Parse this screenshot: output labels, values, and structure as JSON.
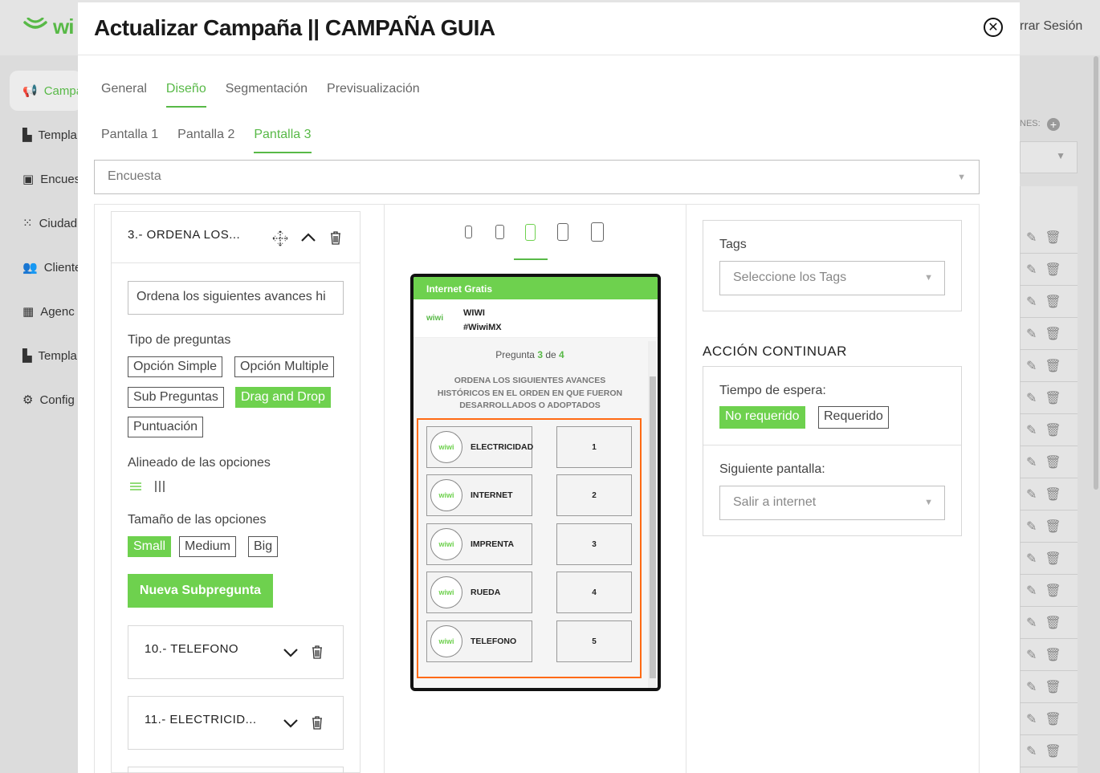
{
  "background": {
    "logo": "wi",
    "logout": "rrar Sesión",
    "sidebar": [
      "Campa",
      "Templa",
      "Encues",
      "Ciudad",
      "Cliente",
      "Agenc",
      "Templa",
      "Config"
    ],
    "right_header": "NES:"
  },
  "modal": {
    "title": "Actualizar Campaña || CAMPAÑA GUIA",
    "close_label": "✕",
    "tabs": [
      "General",
      "Diseño",
      "Segmentación",
      "Previsualización"
    ],
    "subtabs": [
      "Pantalla 1",
      "Pantalla 2",
      "Pantalla 3"
    ],
    "screen_type": "Encuesta"
  },
  "question": {
    "title": "3.- ORDENA LOS...",
    "input_value": "Ordena los siguientes avances hi",
    "tipo_label": "Tipo de preguntas",
    "tipos": [
      "Opción Simple",
      "Opción Multiple",
      "Sub Preguntas",
      "Drag and Drop",
      "Puntuación"
    ],
    "alineado_label": "Alineado de las opciones",
    "tamano_label": "Tamaño de las opciones",
    "tamanos": [
      "Small",
      "Medium",
      "Big"
    ],
    "new_sub_button": "Nueva Subpregunta",
    "subquestions": [
      "10.- TELEFONO",
      "11.- ELECTRICID..."
    ]
  },
  "preview": {
    "bar_title": "Internet Gratis",
    "logo_text": "wiwi",
    "brand_name": "WIWI",
    "brand_tag": "#WiwiMX",
    "pregunta_word": "Pregunta",
    "pregunta_current": "3",
    "pregunta_of": "de",
    "pregunta_total": "4",
    "question_text": "ORDENA LOS SIGUIENTES AVANCES HISTÓRICOS EN EL ORDEN EN QUE FUERON DESARROLLADOS O ADOPTADOS",
    "options": [
      "ELECTRICIDAD",
      "INTERNET",
      "IMPRENTA",
      "RUEDA",
      "TELEFONO"
    ],
    "slots": [
      "1",
      "2",
      "3",
      "4",
      "5"
    ],
    "selected_device_index": 2
  },
  "right": {
    "tags_label": "Tags",
    "tags_placeholder": "Seleccione los Tags",
    "accion_title": "ACCIÓN CONTINUAR",
    "tiempo_label": "Tiempo de espera:",
    "tiempo_options": [
      "No requerido",
      "Requerido"
    ],
    "siguiente_label": "Siguiente pantalla:",
    "siguiente_value": "Salir a internet"
  },
  "colors": {
    "accent": "#6ed14e",
    "accent_text": "#58b947",
    "highlight": "#ff6a13"
  }
}
